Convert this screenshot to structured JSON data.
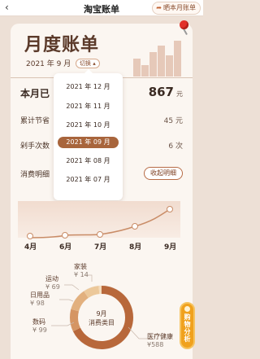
{
  "topbar": {
    "back_icon": "chevron-left",
    "title": "淘宝账单",
    "share_label": "晒本月账单",
    "share_icon": "share-arrow"
  },
  "header": {
    "title": "月度账单",
    "month_label": "2021 年 9 月",
    "switch_label": "切换"
  },
  "dropdown": {
    "options": [
      "2021 年 12 月",
      "2021 年 11 月",
      "2021 年 10 月",
      "2021 年 09 月",
      "2021 年 08 月",
      "2021 年 07 月"
    ],
    "selected": "2021 年 09 月"
  },
  "summary": {
    "spend_label": "本月已",
    "spend_value": "867",
    "spend_unit": "元",
    "savings_label": "累计节省",
    "savings_value": "45 元",
    "orders_label": "剁手次数",
    "orders_value": "6 次",
    "detail_label": "消费明细",
    "collapse_label": "收起明细"
  },
  "trend": {
    "months": [
      "4月",
      "6月",
      "7月",
      "8月",
      "9月"
    ]
  },
  "category_chart": {
    "center_line1": "9月",
    "center_line2": "消费类目",
    "categories": [
      {
        "name": "家装",
        "amount": "¥ 14"
      },
      {
        "name": "运动",
        "amount": "¥ 69"
      },
      {
        "name": "日用品",
        "amount": "¥ 98"
      },
      {
        "name": "数码",
        "amount": "¥ 99"
      },
      {
        "name": "医疗健康",
        "amount": "¥588"
      }
    ]
  },
  "float_button": {
    "label": "购物分析"
  },
  "colors": {
    "accent": "#a8653c",
    "background": "#ede0d6",
    "card": "#fbf6f1",
    "pin": "#e2312a",
    "shopping_button": "#f0a11d"
  }
}
